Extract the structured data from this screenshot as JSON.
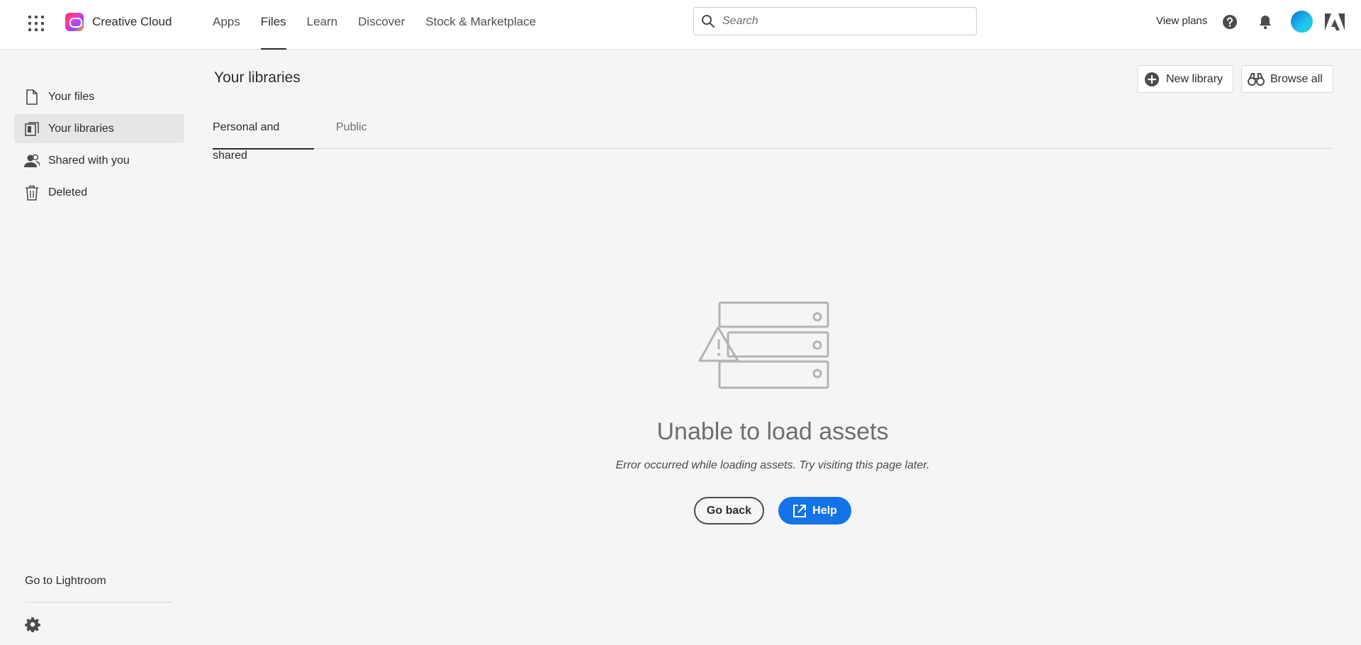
{
  "header": {
    "app_name": "Creative Cloud",
    "nav": [
      {
        "label": "Apps",
        "active": false
      },
      {
        "label": "Files",
        "active": true
      },
      {
        "label": "Learn",
        "active": false
      },
      {
        "label": "Discover",
        "active": false
      },
      {
        "label": "Stock & Marketplace",
        "active": false
      }
    ],
    "search": {
      "placeholder": "Search",
      "value": ""
    },
    "view_plans": "View plans",
    "icons": [
      "apps-grid-icon",
      "help-icon",
      "bell-icon",
      "avatar",
      "adobe-logo-icon"
    ]
  },
  "sidebar": {
    "items": [
      {
        "label": "Your files",
        "icon": "file-icon",
        "active": false
      },
      {
        "label": "Your libraries",
        "icon": "library-icon",
        "active": true
      },
      {
        "label": "Shared with you",
        "icon": "users-icon",
        "active": false
      },
      {
        "label": "Deleted",
        "icon": "trash-icon",
        "active": false
      }
    ],
    "go_to_lightroom": "Go to Lightroom",
    "settings_icon": "gear-icon"
  },
  "main": {
    "title": "Your libraries",
    "new_library": "New library",
    "browse_all": "Browse all",
    "tabs": [
      {
        "label": "Personal and shared",
        "active": true
      },
      {
        "label": "Public",
        "active": false
      }
    ],
    "error": {
      "title": "Unable to load assets",
      "message": "Error occurred while loading assets. Try visiting this page later.",
      "go_back": "Go back",
      "help": "Help"
    }
  },
  "colors": {
    "accent": "#1473e6",
    "background": "#f5f5f5",
    "header": "#ffffff",
    "text": "#2c2c2c"
  }
}
